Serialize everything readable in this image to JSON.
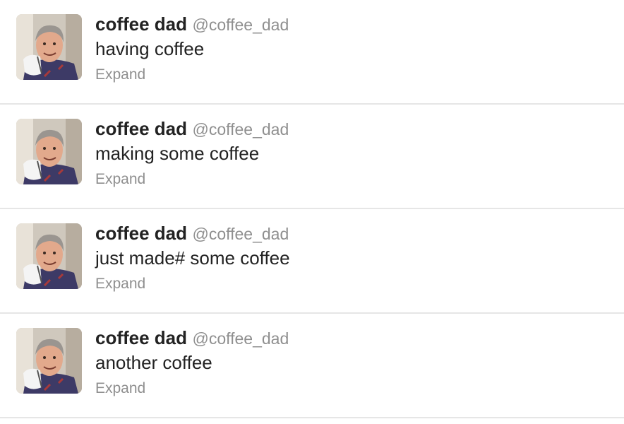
{
  "tweets": [
    {
      "fullname": "coffee dad",
      "username": "@coffee_dad",
      "text": "having coffee",
      "expand_label": "Expand"
    },
    {
      "fullname": "coffee dad",
      "username": "@coffee_dad",
      "text": "making some coffee",
      "expand_label": "Expand"
    },
    {
      "fullname": "coffee dad",
      "username": "@coffee_dad",
      "text": "just made# some coffee",
      "expand_label": "Expand"
    },
    {
      "fullname": "coffee dad",
      "username": "@coffee_dad",
      "text": "another coffee",
      "expand_label": "Expand"
    }
  ]
}
